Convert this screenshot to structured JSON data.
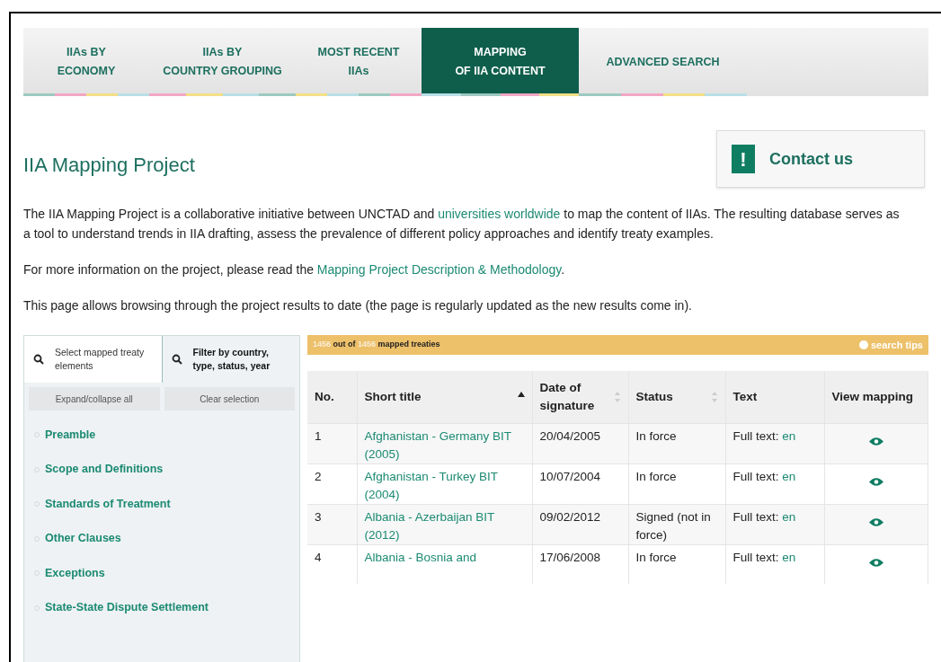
{
  "nav_tabs": [
    {
      "lines": [
        "IIAs BY",
        "ECONOMY"
      ],
      "selected": false
    },
    {
      "lines": [
        "IIAs BY",
        "COUNTRY GROUPING"
      ],
      "selected": false
    },
    {
      "lines": [
        "MOST RECENT",
        "IIAs"
      ],
      "selected": false
    },
    {
      "lines": [
        "MAPPING",
        "OF IIA CONTENT"
      ],
      "selected": true
    },
    {
      "lines": [
        "ADVANCED SEARCH"
      ],
      "selected": false
    }
  ],
  "page_title": "IIA Mapping Project",
  "contact_button": {
    "icon": "!",
    "label": "Contact us"
  },
  "paragraphs": [
    [
      {
        "text": "The IIA Mapping Project is a collaborative initiative between UNCTAD and ",
        "link": false
      },
      {
        "text": "universities worldwide",
        "link": true
      },
      {
        "text": " to map the content of IIAs. The resulting database serves as a tool to understand trends in IIA drafting, assess the prevalence of different policy approaches and identify treaty examples.",
        "link": false
      }
    ],
    [
      {
        "text": "For more information on the project, please read the ",
        "link": false
      },
      {
        "text": "Mapping Project Description & Methodology",
        "link": true
      },
      {
        "text": ".",
        "link": false
      }
    ],
    [
      {
        "text": "This page allows browsing through the project results to date (the page is regularly updated as the new results come in).",
        "link": false
      }
    ]
  ],
  "filter_tabs": [
    {
      "label": "Select mapped treaty elements",
      "selected": false
    },
    {
      "label": "Filter by country, type, status, year",
      "selected": true
    }
  ],
  "panel_buttons": [
    "Expand/collapse all",
    "Clear selection"
  ],
  "tree_items": [
    "Preamble",
    "Scope and Definitions",
    "Standards of Treatment",
    "Other Clauses",
    "Exceptions",
    "State-State Dispute Settlement"
  ],
  "results_bar": {
    "shown": "1456",
    "between": "out of",
    "total": "1456",
    "suffix": "mapped treaties",
    "tips": "search tips"
  },
  "table": {
    "columns": [
      {
        "label": "No.",
        "sortable": false,
        "sorted": false
      },
      {
        "label": "Short title",
        "sortable": true,
        "sorted": true
      },
      {
        "label": "Date of signature",
        "sortable": true,
        "sorted": false
      },
      {
        "label": "Status",
        "sortable": true,
        "sorted": false
      },
      {
        "label": "Text",
        "sortable": false,
        "sorted": false
      },
      {
        "label": "View mapping",
        "sortable": false,
        "sorted": false
      }
    ],
    "rows": [
      {
        "no": "1",
        "title": "Afghanistan - Germany BIT (2005)",
        "date": "20/04/2005",
        "status": "In force",
        "text_label": "Full text:",
        "lang": "en"
      },
      {
        "no": "2",
        "title": "Afghanistan - Turkey BIT (2004)",
        "date": "10/07/2004",
        "status": "In force",
        "text_label": "Full text:",
        "lang": "en"
      },
      {
        "no": "3",
        "title": "Albania - Azerbaijan BIT (2012)",
        "date": "09/02/2012",
        "status": "Signed (not in force)",
        "text_label": "Full text:",
        "lang": "en"
      },
      {
        "no": "4",
        "title": "Albania - Bosnia and",
        "date": "17/06/2008",
        "status": "In force",
        "text_label": "Full text:",
        "lang": "en"
      }
    ]
  }
}
